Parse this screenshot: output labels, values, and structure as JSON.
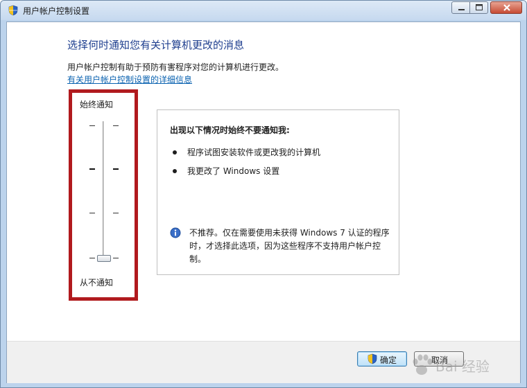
{
  "window": {
    "title": "用户帐户控制设置",
    "icons": {
      "app": "uac-shield-icon",
      "minimize": "minimize-icon",
      "maximize": "maximize-icon",
      "close": "close-icon"
    }
  },
  "main": {
    "heading": "选择何时通知您有关计算机更改的消息",
    "description": "用户帐户控制有助于预防有害程序对您的计算机进行更改。",
    "link": "有关用户帐户控制设置的详细信息"
  },
  "slider": {
    "top_label": "始终通知",
    "bottom_label": "从不通知",
    "levels": 4,
    "selected_level": 1,
    "highlight_color": "#b11a1e"
  },
  "info": {
    "title": "出现以下情况时始终不要通知我:",
    "items": [
      "程序试图安装软件或更改我的计算机",
      "我更改了 Windows 设置"
    ],
    "note_icon": "info-icon",
    "note": "不推荐。仅在需要使用未获得 Windows 7 认证的程序时，才选择此选项，因为这些程序不支持用户帐户控制。"
  },
  "buttons": {
    "ok": "确定",
    "cancel": "取消",
    "ok_icon": "uac-shield-icon"
  },
  "watermark": {
    "text": "Bai 经验",
    "icon": "paw-icon"
  }
}
